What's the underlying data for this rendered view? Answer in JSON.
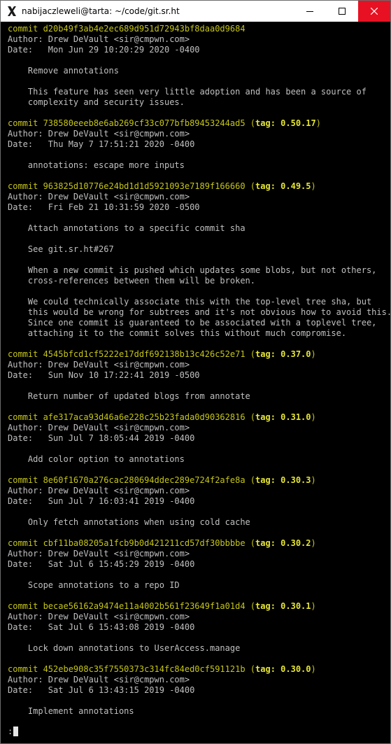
{
  "window": {
    "title": "nabijaczleweli@tarta: ~/code/git.sr.ht",
    "icons": {
      "app": "x-terminal-icon",
      "minimize": "minimize-icon",
      "maximize": "maximize-icon",
      "close": "close-icon"
    },
    "close_color": "#e81123"
  },
  "colors": {
    "background": "#000000",
    "text": "#c0c0c0",
    "commit": "#c5c519",
    "tag": "#e5e533"
  },
  "log": {
    "commits": [
      {
        "hash": "d20b49f3ab4e2ec689d951d72943bf8daa0d9684",
        "tag": "",
        "author": "Drew DeVault <sir@cmpwn.com>",
        "date": "Mon Jun 29 10:20:29 2020 -0400",
        "message": [
          "Remove annotations",
          "",
          "This feature has seen very little adoption and has been a source of",
          "complexity and security issues."
        ]
      },
      {
        "hash": "738580eeeb8e6ab269cf33c077bfb89453244ad5",
        "tag": "0.50.17",
        "author": "Drew DeVault <sir@cmpwn.com>",
        "date": "Thu May 7 17:51:21 2020 -0400",
        "message": [
          "annotations: escape more inputs"
        ]
      },
      {
        "hash": "963825d10776e24bd1d1d5921093e7189f166660",
        "tag": "0.49.5",
        "author": "Drew DeVault <sir@cmpwn.com>",
        "date": "Fri Feb 21 10:31:59 2020 -0500",
        "message": [
          "Attach annotations to a specific commit sha",
          "",
          "See git.sr.ht#267",
          "",
          "When a new commit is pushed which updates some blobs, but not others,",
          "cross-references between them will be broken.",
          "",
          "We could technically associate this with the top-level tree sha, but",
          "this would be wrong for subtrees and it's not obvious how to avoid this.",
          "Since one commit is guaranteed to be associated with a toplevel tree,",
          "attaching it to the commit solves this without much compromise."
        ]
      },
      {
        "hash": "4545bfcd1cf5222e17ddf692138b13c426c52e71",
        "tag": "0.37.0",
        "author": "Drew DeVault <sir@cmpwn.com>",
        "date": "Sun Nov 10 17:22:41 2019 -0500",
        "message": [
          "Return number of updated blogs from annotate"
        ]
      },
      {
        "hash": "afe317aca93d46a6e228c25b23fada0d90362816",
        "tag": "0.31.0",
        "author": "Drew DeVault <sir@cmpwn.com>",
        "date": "Sun Jul 7 18:05:44 2019 -0400",
        "message": [
          "Add color option to annotations"
        ]
      },
      {
        "hash": "8e60f1670a276cac280694ddec289e724f2afe8a",
        "tag": "0.30.3",
        "author": "Drew DeVault <sir@cmpwn.com>",
        "date": "Sun Jul 7 16:03:41 2019 -0400",
        "message": [
          "Only fetch annotations when using cold cache"
        ]
      },
      {
        "hash": "cbf11ba08205a1fcb9b0d421211cd57df30bbbbe",
        "tag": "0.30.2",
        "author": "Drew DeVault <sir@cmpwn.com>",
        "date": "Sat Jul 6 15:45:29 2019 -0400",
        "message": [
          "Scope annotations to a repo ID"
        ]
      },
      {
        "hash": "becae56162a9474e11a4002b561f23649f1a01d4",
        "tag": "0.30.1",
        "author": "Drew DeVault <sir@cmpwn.com>",
        "date": "Sat Jul 6 15:43:08 2019 -0400",
        "message": [
          "Lock down annotations to UserAccess.manage"
        ]
      },
      {
        "hash": "452ebe908c35f7550373c314fc84ed0cf591121b",
        "tag": "0.30.0",
        "author": "Drew DeVault <sir@cmpwn.com>",
        "date": "Sat Jul 6 13:43:15 2019 -0400",
        "message": [
          "Implement annotations"
        ]
      }
    ]
  },
  "pager": {
    "prompt": ":"
  }
}
